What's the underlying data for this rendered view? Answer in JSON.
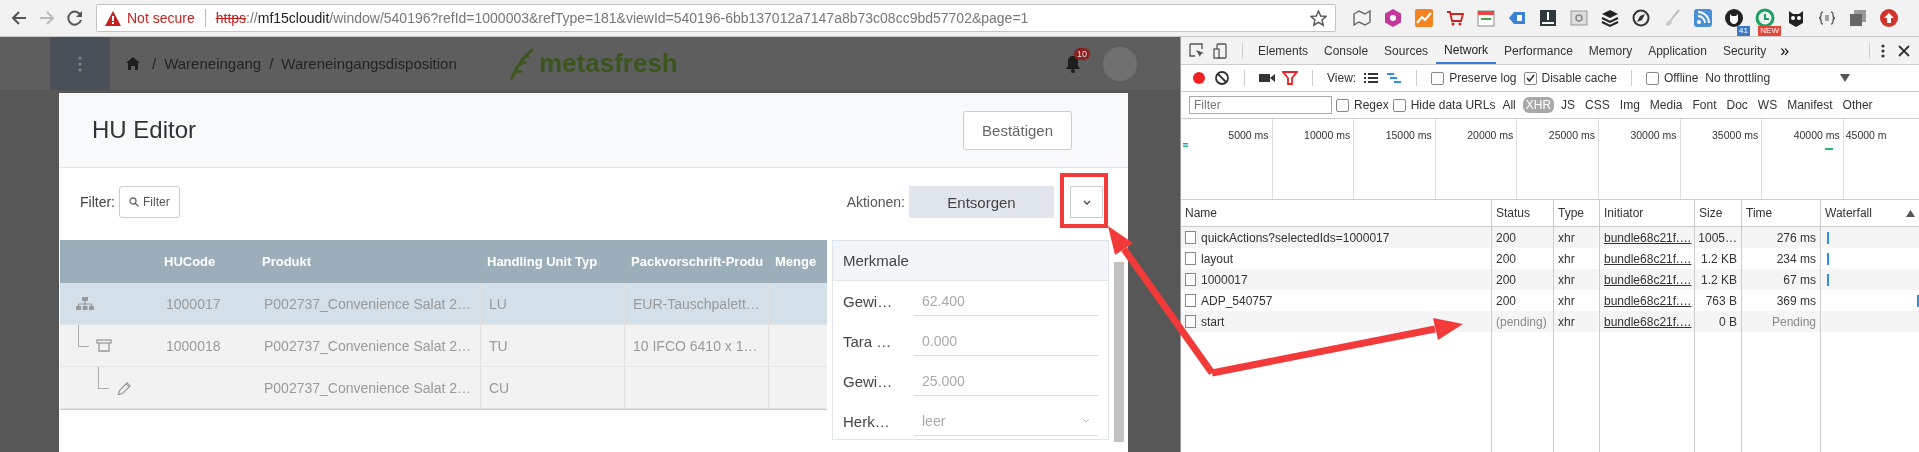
{
  "browser": {
    "security_warning": "Not secure",
    "url_scheme": "https",
    "url_separator": "://",
    "url_host": "mf15cloudit",
    "url_path": "/window/540196?refId=1000003&refType=181&viewId=540196-6bb137012a7147a8b73c08cc9bd57702&page=1",
    "extension_badges": [
      "41",
      "NEW"
    ]
  },
  "app_header": {
    "breadcrumb_separator": "/",
    "breadcrumbs": [
      "Wareneingang",
      "Wareneingangsdisposition"
    ],
    "logo": "metasfresh",
    "notification_count": "10"
  },
  "modal": {
    "title": "HU Editor",
    "confirm_button": "Bestätigen",
    "filter_label": "Filter:",
    "filter_button": "Filter",
    "actions_label": "Aktionen:",
    "action_button": "Entsorgen"
  },
  "hu_table": {
    "columns": [
      "HUCode",
      "Produkt",
      "Handling Unit Typ",
      "Packvorschrift-Produ",
      "Menge"
    ],
    "rows": [
      {
        "kind": "lu",
        "selected": true,
        "hucode": "1000017",
        "product": "P002737_Convenience Salat 2…",
        "unit_type": "LU",
        "packing": "EUR-Tauschpalett…",
        "children": [
          {
            "kind": "tu",
            "selected": false,
            "hucode": "1000018",
            "product": "P002737_Convenience Salat 2…",
            "unit_type": "TU",
            "packing": "10 IFCO 6410 x 1…",
            "children": [
              {
                "kind": "cu",
                "selected": false,
                "product": "P002737_Convenience Salat 2…",
                "unit_type": "CU"
              }
            ]
          }
        ]
      }
    ]
  },
  "attributes": {
    "title": "Merkmale",
    "fields": [
      {
        "kind": "text",
        "label": "Gewi…",
        "value": "62.400"
      },
      {
        "kind": "text",
        "label": "Tara …",
        "value": "0.000"
      },
      {
        "kind": "text",
        "label": "Gewi…",
        "value": "25.000"
      },
      {
        "kind": "select",
        "label": "Herk…",
        "value": "leer"
      }
    ]
  },
  "devtools": {
    "tabs": [
      {
        "label": "Elements",
        "selected": false
      },
      {
        "label": "Console",
        "selected": false
      },
      {
        "label": "Sources",
        "selected": false
      },
      {
        "label": "Network",
        "selected": true
      },
      {
        "label": "Performance",
        "selected": false
      },
      {
        "label": "Memory",
        "selected": false
      },
      {
        "label": "Application",
        "selected": false
      },
      {
        "label": "Security",
        "selected": false
      }
    ],
    "more_tabs": "»",
    "toolbar": {
      "recording": true,
      "filter_active": true,
      "view_label": "View:",
      "view_modes": [
        {
          "kind": "list",
          "selected": false
        },
        {
          "kind": "overview",
          "selected": true
        }
      ],
      "options": [
        {
          "label": "Preserve log",
          "checked": false
        },
        {
          "label": "Disable cache",
          "checked": true
        }
      ],
      "offline": {
        "label": "Offline",
        "checked": false
      },
      "throttling": "No throttling"
    },
    "filter_bar": {
      "placeholder": "Filter",
      "options": [
        {
          "label": "Regex",
          "checked": false
        },
        {
          "label": "Hide data URLs",
          "checked": false
        }
      ],
      "types": [
        {
          "label": "All",
          "selected": false
        },
        {
          "label": "XHR",
          "selected": true
        },
        {
          "label": "JS",
          "selected": false
        },
        {
          "label": "CSS",
          "selected": false
        },
        {
          "label": "Img",
          "selected": false
        },
        {
          "label": "Media",
          "selected": false
        },
        {
          "label": "Font",
          "selected": false
        },
        {
          "label": "Doc",
          "selected": false
        },
        {
          "label": "WS",
          "selected": false
        },
        {
          "label": "Manifest",
          "selected": false
        },
        {
          "label": "Other",
          "selected": false
        }
      ]
    },
    "overview_ticks": [
      "5000 ms",
      "10000 ms",
      "15000 ms",
      "20000 ms",
      "25000 ms",
      "30000 ms",
      "35000 ms",
      "40000 ms",
      "45000 m"
    ],
    "requests": {
      "columns": [
        "Name",
        "Status",
        "Type",
        "Initiator",
        "Size",
        "Time",
        "Waterfall"
      ],
      "rows": [
        {
          "name": "quickActions?selectedIds=1000017",
          "status": "200",
          "type": "xhr",
          "initiator": "bundle68c21f.…",
          "size": "1005…",
          "time": "276 ms",
          "pending": false,
          "kind": "early"
        },
        {
          "name": "layout",
          "status": "200",
          "type": "xhr",
          "initiator": "bundle68c21f.…",
          "size": "1.2 KB",
          "time": "234 ms",
          "pending": false,
          "kind": "early"
        },
        {
          "name": "1000017",
          "status": "200",
          "type": "xhr",
          "initiator": "bundle68c21f.…",
          "size": "1.2 KB",
          "time": "67 ms",
          "pending": false,
          "kind": "early"
        },
        {
          "name": "ADP_540757",
          "status": "200",
          "type": "xhr",
          "initiator": "bundle68c21f.…",
          "size": "763 B",
          "time": "369 ms",
          "pending": false,
          "kind": "late"
        },
        {
          "name": "start",
          "status": "(pending)",
          "type": "xhr",
          "initiator": "bundle68c21f.…",
          "size": "0 B",
          "time": "Pending",
          "pending": true,
          "kind": "waiting"
        }
      ]
    }
  }
}
